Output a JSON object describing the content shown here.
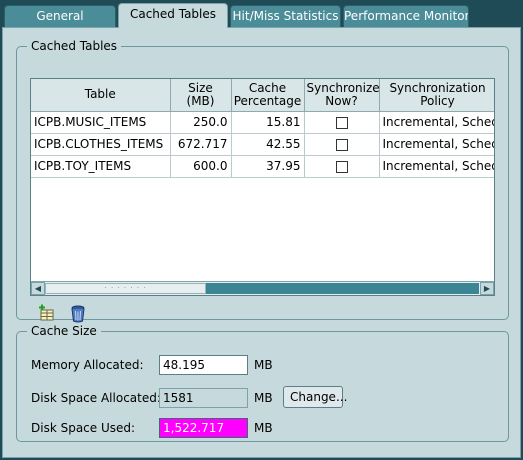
{
  "tabs": [
    {
      "label": "General"
    },
    {
      "label": "Cached Tables"
    },
    {
      "label": "Hit/Miss Statistics"
    },
    {
      "label": "Performance Monitor"
    }
  ],
  "cached_tables": {
    "legend": "Cached Tables",
    "columns": [
      "Table",
      "Size (MB)",
      "Cache Percentage",
      "Synchronize Now?",
      "Synchronization Policy"
    ],
    "rows": [
      {
        "table": "ICPB.MUSIC_ITEMS",
        "size": "250.0",
        "percentage": "15.81",
        "sync_now": false,
        "policy": "Incremental, Schedu"
      },
      {
        "table": "ICPB.CLOTHES_ITEMS",
        "size": "672.717",
        "percentage": "42.55",
        "sync_now": false,
        "policy": "Incremental, Schedu"
      },
      {
        "table": "ICPB.TOY_ITEMS",
        "size": "600.0",
        "percentage": "37.95",
        "sync_now": false,
        "policy": "Incremental, Schedu"
      }
    ],
    "scroll_left_icon": "triangle-left-icon",
    "scroll_right_icon": "triangle-right-icon",
    "add_icon": "add-table-icon",
    "delete_icon": "trash-icon"
  },
  "cache_size": {
    "legend": "Cache Size",
    "memory_label": "Memory Allocated:",
    "memory_value": "48.195",
    "memory_unit": "MB",
    "disk_alloc_label": "Disk Space Allocated:",
    "disk_alloc_value": "1581",
    "disk_alloc_unit": "MB",
    "change_button": "Change...",
    "disk_used_label": "Disk Space Used:",
    "disk_used_value": "1,522.717",
    "disk_used_unit": "MB",
    "disk_used_fill_color": "#ff00ff"
  },
  "colors": {
    "background": "#1f4b57",
    "panel": "#c6d9dc",
    "tab_inactive": "#4a8c97"
  }
}
